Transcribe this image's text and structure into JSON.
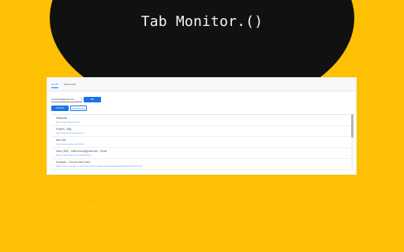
{
  "hero": {
    "title": "Tab Monitor.()"
  },
  "tabs": {
    "list_label": "List All",
    "screenshot_label": "Screenshot"
  },
  "controls": {
    "email_value": "someone@gmail.com",
    "email_caret": "▾",
    "go_label": "OK",
    "primary_action": "All Tabs",
    "secondary_action": "All Windows"
  },
  "items": [
    {
      "title": "Wikipedia",
      "url": "https://www.wikipedia.org/"
    },
    {
      "title": "Experts - Bitly",
      "url": "https://bitly.com/pages/experts"
    },
    {
      "title": "New Tab",
      "url": "https://www.google.com/?hl=en"
    },
    {
      "title": "Inbox (282) - editor.inbox@gmail.com - Gmail",
      "url": "https://mail.google.com/mail/u/0/#inbox"
    },
    {
      "title": "Unsplash - Chrome Web Store",
      "url": "https://chrome.google.com/webstore/detail/unsplash-instant/pejkokffkapolfffcgbmdmhdelanoaih"
    }
  ],
  "footer": {
    "note_a": "Tab list",
    "note_b": "Preview"
  }
}
